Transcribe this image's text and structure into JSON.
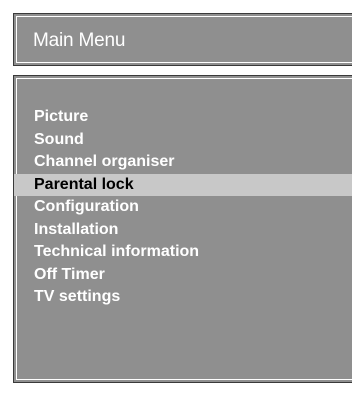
{
  "header": {
    "title": "Main Menu"
  },
  "menu": {
    "items": [
      {
        "label": "Picture",
        "selected": false
      },
      {
        "label": "Sound",
        "selected": false
      },
      {
        "label": "Channel organiser",
        "selected": false
      },
      {
        "label": "Parental lock",
        "selected": true
      },
      {
        "label": "Configuration",
        "selected": false
      },
      {
        "label": "Installation",
        "selected": false
      },
      {
        "label": "Technical information",
        "selected": false
      },
      {
        "label": "Off Timer",
        "selected": false
      },
      {
        "label": "TV settings",
        "selected": false
      }
    ]
  },
  "colors": {
    "panel_bg": "#8f8f8f",
    "text": "#ffffff",
    "highlight_bg": "#c8c8c8",
    "highlight_text": "#000000"
  }
}
